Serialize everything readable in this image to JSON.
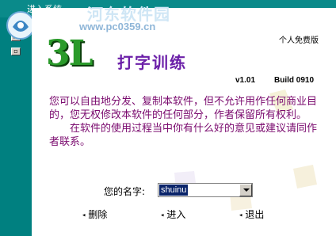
{
  "window": {
    "title": "进入系统"
  },
  "watermark": {
    "text": "河东软件园",
    "url": "www.pc0359.cn"
  },
  "brand": {
    "logo_text": "3L",
    "title": "打字训练",
    "edition": "个人免费版",
    "version": "v1.01",
    "build": "Build 0910"
  },
  "description": {
    "paragraph1": "您可以自由地分发、复制本软件，但不允许用作任何商业目的，您无权修改本软件的任何部分，作者保留所有权利。",
    "paragraph2": "在软件的使用过程当中你有什么好的意见或建议请同作者联系。"
  },
  "form": {
    "name_label": "您的名字:",
    "name_value": "shuinu"
  },
  "buttons": {
    "delete": "删除",
    "enter": "进入",
    "exit": "退出"
  },
  "colors": {
    "window_bg": "#008080",
    "text_purple": "#7a0a6e",
    "title_purple": "#6b1fa8",
    "brand_green": "#2a9a2a"
  }
}
